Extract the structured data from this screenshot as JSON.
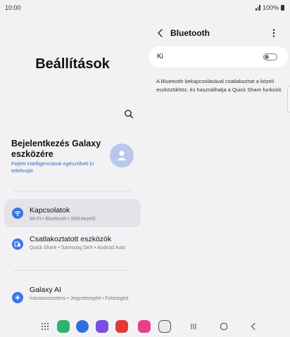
{
  "status_bar": {
    "time": "10:00",
    "battery": "100%"
  },
  "settings": {
    "title": "Beállítások",
    "account": {
      "title": "Bejelentkezés Galaxy eszközére",
      "subtitle": "Fejlett intelligenciával egészítheti ki telefonját."
    },
    "items": [
      {
        "label": "Kapcsolatok",
        "sub": "Wi-Fi • Bluetooth • SIM-kezelő",
        "icon": "wifi-icon",
        "color": "#3e74e8",
        "selected": true
      },
      {
        "label": "Csatlakoztatott eszközök",
        "sub": "Quick Share • Samsung DeX • Android Auto",
        "icon": "devices-icon",
        "color": "#3e74e8",
        "selected": false
      },
      {
        "label": "Galaxy AI",
        "sub": "Írássasszisztens • Jegyzetsegéd • Fotósegéd",
        "icon": "galaxy-ai-icon",
        "color": "#3e74e8",
        "selected": false
      }
    ]
  },
  "bluetooth": {
    "title": "Bluetooth",
    "toggle_label": "Ki",
    "toggle_on": false,
    "description": "A Bluetooth bekapcsolásával csatlakozhat a közeli eszközökhöz, és használhatja a Quick Share funkciót."
  },
  "nav_bar": {
    "apps": [
      {
        "icon": "app-drawer-icon",
        "color": "#444444"
      },
      {
        "icon": "phone-icon",
        "color": "#2fb36b"
      },
      {
        "icon": "messages-icon",
        "color": "#2f6fe0"
      },
      {
        "icon": "internet-icon",
        "color": "#7b4fe0"
      },
      {
        "icon": "notes-icon",
        "color": "#e4393c"
      },
      {
        "icon": "gallery-icon",
        "color": "#e5408f"
      },
      {
        "icon": "camera-icon",
        "color": "#555555"
      }
    ],
    "buttons": [
      "recents-icon",
      "home-icon",
      "back-icon"
    ]
  }
}
